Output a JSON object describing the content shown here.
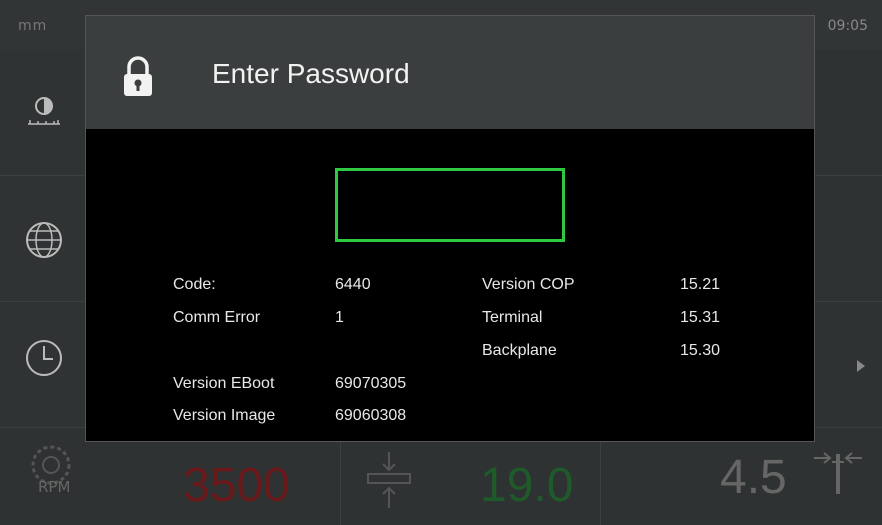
{
  "status_bar": {
    "unit": "mm",
    "time": "09:05"
  },
  "side_icons": [
    "contrast-icon",
    "globe-icon",
    "clock-icon"
  ],
  "bottom": {
    "rpm_value": "3500",
    "rpm_label": "RPM",
    "feed_value": "19.0",
    "dim_value": "4.5"
  },
  "dialog": {
    "title": "Enter Password",
    "password_value": "",
    "info_left": [
      {
        "label": "Code:",
        "value": "6440"
      },
      {
        "label": "Comm Error",
        "value": "1"
      },
      {
        "label": "Version EBoot",
        "value": "69070305"
      },
      {
        "label": "Version Image",
        "value": "69060308"
      }
    ],
    "info_right": [
      {
        "label": "Version COP",
        "value": "15.21"
      },
      {
        "label": "Terminal",
        "value": "15.31"
      },
      {
        "label": "Backplane",
        "value": "15.30"
      }
    ]
  },
  "colors": {
    "accent_green": "#2ec942",
    "rpm_red": "#6a1a1a",
    "feed_green": "#1f5a2a"
  }
}
